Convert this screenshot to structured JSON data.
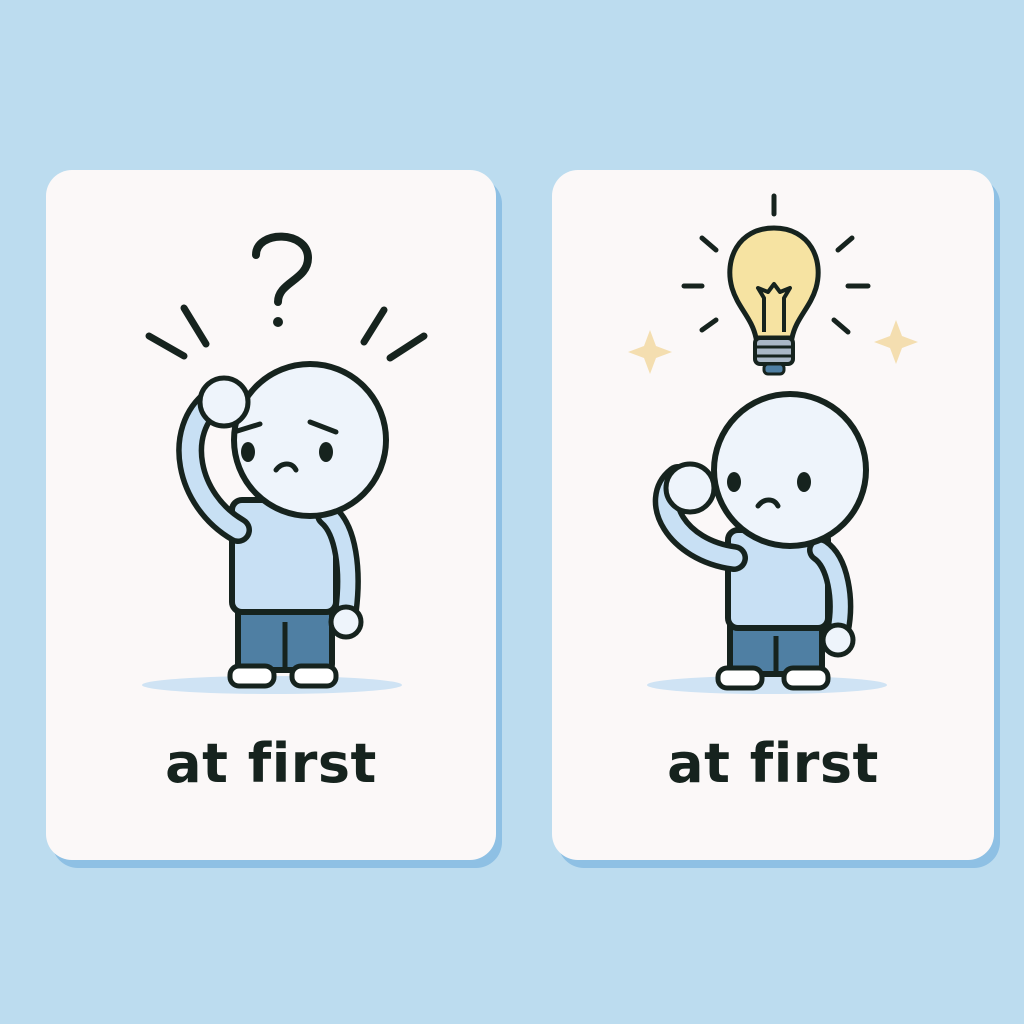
{
  "panels": [
    {
      "caption": "at first",
      "above_icon": "question-mark-icon",
      "expression": "worried"
    },
    {
      "caption": "at first",
      "above_icon": "lightbulb-icon",
      "expression": "puzzled"
    }
  ],
  "colors": {
    "background": "#bcdcef",
    "card": "#fbf8f8",
    "card_shadow": "#8ec0e4",
    "outline": "#16231e",
    "shirt": "#c8e0f4",
    "pants": "#4f7fa3",
    "bulb": "#f6e3a2",
    "sparkle": "#f4deb0"
  }
}
